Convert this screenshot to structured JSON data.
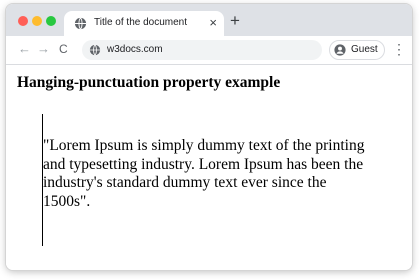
{
  "browser": {
    "tab": {
      "title": "Title of the document",
      "close_icon": "×",
      "favicon": "globe-icon"
    },
    "new_tab_icon": "+",
    "nav": {
      "back": "←",
      "forward": "→",
      "reload": "C"
    },
    "address": {
      "url": "w3docs.com",
      "site_icon": "globe-icon"
    },
    "profile": {
      "label": "Guest",
      "icon": "person-icon"
    },
    "menu_icon": "⋮",
    "traffic_lights": [
      "#ff5f57",
      "#febc2e",
      "#28c840"
    ]
  },
  "page": {
    "heading": "Hanging-punctuation property example",
    "paragraph": "\"Lorem Ipsum is simply dummy text of the printing and typesetting industry. Lorem Ipsum has been the industry's standard dummy text ever since the 1500s\"."
  }
}
